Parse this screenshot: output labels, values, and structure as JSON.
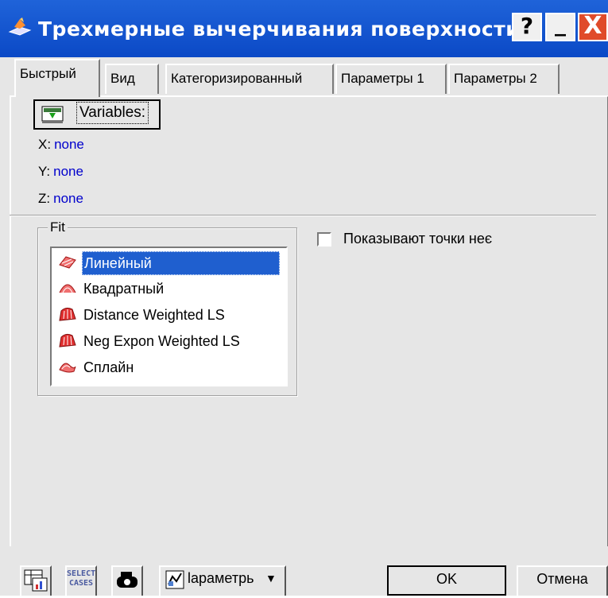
{
  "window": {
    "title": "Трехмерные вычерчивания поверхности",
    "help": "?",
    "minimize": "_",
    "close": "X"
  },
  "tabs": [
    "Быстрый",
    "Вид",
    "Категоризированный",
    "Параметры 1",
    "Параметры 2"
  ],
  "variables": {
    "button_label": "Variables:",
    "x_label": "X:",
    "x_value": "none",
    "y_label": "Y:",
    "y_value": "none",
    "z_label": "Z:",
    "z_value": "none"
  },
  "fit": {
    "legend": "Fit",
    "items": [
      "Линейный",
      "Квадратный",
      "Distance Weighted LS",
      "Neg Expon Weighted LS",
      "Сплайн"
    ],
    "selected": "Линейный"
  },
  "show_points": {
    "label": "Показывают точки неє",
    "checked": false
  },
  "bottom": {
    "select_cases_line1": "SELECT",
    "select_cases_line2": "CASES",
    "params_label": "lapaметрь",
    "ok": "OK",
    "cancel": "Отмена"
  },
  "colors": {
    "titlebar": "#0b49c6",
    "selection": "#1f5fcf",
    "value_blue": "#0000cc",
    "close_button": "#e04b2a"
  }
}
